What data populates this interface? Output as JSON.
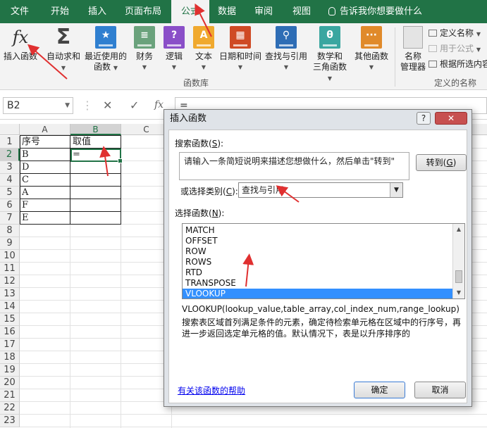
{
  "tabs": [
    {
      "label": "文件"
    },
    {
      "label": "开始"
    },
    {
      "label": "插入"
    },
    {
      "label": "页面布局"
    },
    {
      "label": "公式",
      "active": true
    },
    {
      "label": "数据"
    },
    {
      "label": "审阅"
    },
    {
      "label": "视图"
    }
  ],
  "tell_me": "告诉我你想要做什么",
  "ribbon": {
    "insert_function": "插入函数",
    "autosum": "自动求和",
    "recent_line1": "最近使用的",
    "recent_line2": "函数",
    "financial": "财务",
    "logical": "逻辑",
    "text": "文本",
    "datetime": "日期和时间",
    "lookup": "查找与引用",
    "math_line1": "数学和",
    "math_line2": "三角函数",
    "more": "其他函数",
    "library_group": "函数库",
    "name_manager_line1": "名称",
    "name_manager_line2": "管理器",
    "define_name": "定义名称",
    "use_in_formula": "用于公式",
    "create_from_selection": "根据所选内容",
    "defined_names_group": "定义的名称",
    "colors": {
      "financial": "#6aa27c",
      "logical": "#8a4fc8",
      "text": "#f0a92e",
      "datetime": "#cf4a24",
      "lookup": "#2e6db5",
      "math": "#3aa6a0",
      "more": "#e08a2a",
      "autosum_blue": "#2f7fd0"
    }
  },
  "formula_bar": {
    "name_box": "B2",
    "cancel_symbol": "✕",
    "enter_symbol": "✓",
    "fx_symbol": "fx",
    "content": "="
  },
  "grid": {
    "columns": [
      "A",
      "B",
      "C"
    ],
    "rows": [
      "1",
      "2",
      "3",
      "4",
      "5",
      "6",
      "7",
      "8",
      "9",
      "10",
      "11",
      "12",
      "13",
      "14",
      "15",
      "16",
      "17",
      "18",
      "19",
      "20",
      "21",
      "22",
      "23"
    ],
    "cells": {
      "A1": "序号",
      "B1": "取值",
      "A2": "B",
      "B2": "=",
      "A3": "D",
      "A4": "C",
      "A5": "A",
      "A6": "F",
      "A7": "E"
    }
  },
  "dialog": {
    "title": "插入函数",
    "help_symbol": "?",
    "close_symbol": "✕",
    "search_label": "搜索函数(S):",
    "search_label_main": "搜索函数(",
    "search_label_key": "S",
    "search_label_end": "):",
    "search_placeholder": "请输入一条简短说明来描述您想做什么，然后单击\"转到\"",
    "goto_main": "转到(",
    "goto_key": "G",
    "goto_end": ")",
    "category_main": "或选择类别(",
    "category_key": "C",
    "category_end": "):",
    "category_value": "查找与引用",
    "select_main": "选择函数(",
    "select_key": "N",
    "select_end": "):",
    "functions": [
      "MATCH",
      "OFFSET",
      "ROW",
      "ROWS",
      "RTD",
      "TRANSPOSE",
      "VLOOKUP"
    ],
    "selected_function": "VLOOKUP",
    "syntax": "VLOOKUP(lookup_value,table_array,col_index_num,range_lookup)",
    "description": "搜索表区域首列满足条件的元素，确定待检索单元格在区域中的行序号，再进一步返回选定单元格的值。默认情况下，表是以升序排序的",
    "help_link": "有关该函数的帮助",
    "ok": "确定",
    "cancel": "取消"
  }
}
